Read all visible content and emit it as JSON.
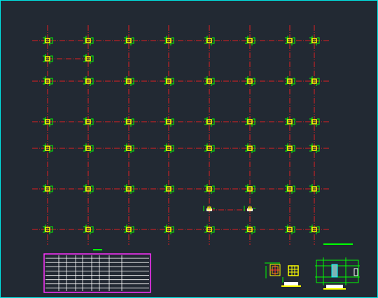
{
  "drawing": {
    "background": "#222933",
    "frame_color": "#00e5e5",
    "axis_color": "#e02020",
    "column_color": "#ffff00",
    "tag_color": "#00ff00",
    "table_border_color": "#ff33ff",
    "table_line_color": "#ffffff",
    "grid": {
      "column_lines": 8,
      "row_lines": 7,
      "columns_per_row": 8
    },
    "icons": [
      "column-symbol-icon",
      "green-leader-tag-icon"
    ]
  }
}
